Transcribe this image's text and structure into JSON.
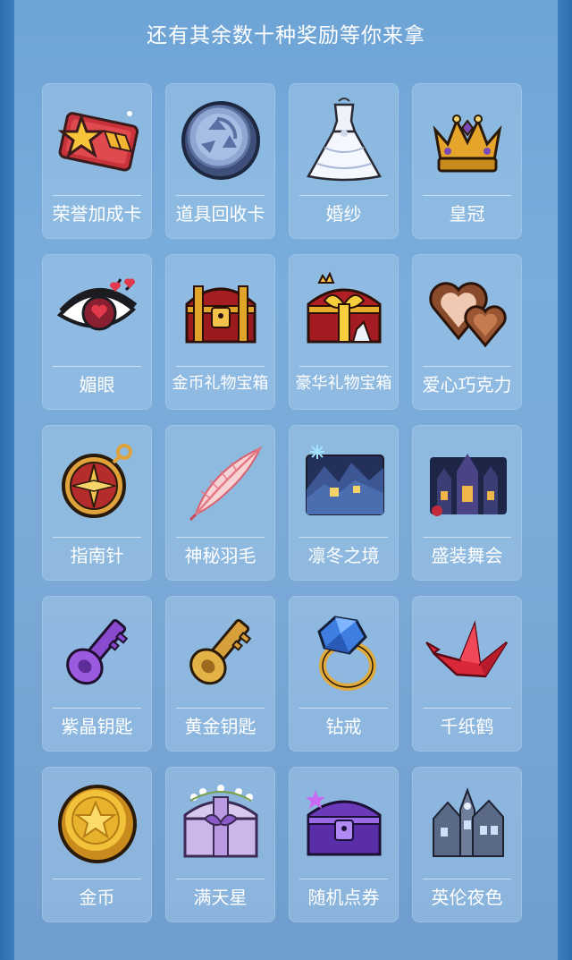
{
  "header": {
    "title": "还有其余数十种奖励等你来拿"
  },
  "rewards": [
    {
      "label": "荣誉加成卡",
      "icon": "honor-card-icon"
    },
    {
      "label": "道具回收卡",
      "icon": "recycle-coin-icon"
    },
    {
      "label": "婚纱",
      "icon": "wedding-dress-icon"
    },
    {
      "label": "皇冠",
      "icon": "crown-icon"
    },
    {
      "label": "媚眼",
      "icon": "charming-eye-icon"
    },
    {
      "label": "金币礼物宝箱",
      "icon": "gold-treasure-chest-icon"
    },
    {
      "label": "豪华礼物宝箱",
      "icon": "luxury-treasure-chest-icon"
    },
    {
      "label": "爱心巧克力",
      "icon": "heart-chocolate-icon"
    },
    {
      "label": "指南针",
      "icon": "compass-icon"
    },
    {
      "label": "神秘羽毛",
      "icon": "mysterious-feather-icon"
    },
    {
      "label": "凛冬之境",
      "icon": "winter-realm-scene-icon"
    },
    {
      "label": "盛装舞会",
      "icon": "grand-ball-castle-icon"
    },
    {
      "label": "紫晶钥匙",
      "icon": "amethyst-key-icon"
    },
    {
      "label": "黄金钥匙",
      "icon": "golden-key-icon"
    },
    {
      "label": "钻戒",
      "icon": "diamond-ring-icon"
    },
    {
      "label": "千纸鹤",
      "icon": "paper-crane-icon"
    },
    {
      "label": "金币",
      "icon": "gold-coin-icon"
    },
    {
      "label": "满天星",
      "icon": "babys-breath-chest-icon"
    },
    {
      "label": "随机点券",
      "icon": "random-coupon-chest-icon"
    },
    {
      "label": "英伦夜色",
      "icon": "british-night-house-icon"
    }
  ]
}
